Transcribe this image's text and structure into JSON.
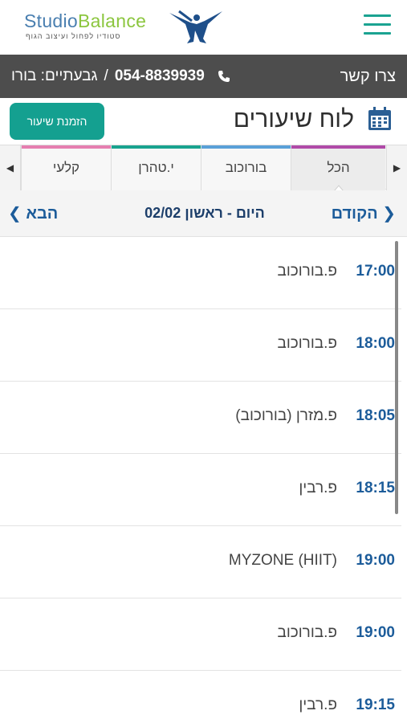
{
  "header": {
    "logo_studio": "Studio",
    "logo_balance": "Balance",
    "logo_tagline": "סטודיו לפחול ועיצוב הגוף"
  },
  "contact": {
    "label": "צרו קשר",
    "phone": "054-8839939",
    "branch": "גבעתיים: בורו",
    "separator": "/"
  },
  "title": {
    "text": "לוח שיעורים",
    "book_button": "הזמנת שיעור"
  },
  "tabs": [
    {
      "label": "הכל",
      "color": "#b04aa8"
    },
    {
      "label": "בורוכוב",
      "color": "#5aa0d8"
    },
    {
      "label": "י.טהרן",
      "color": "#19a38f"
    },
    {
      "label": "קלעי",
      "color": "#e67fb0"
    }
  ],
  "date_nav": {
    "prev": "הקודם",
    "next": "הבא",
    "date": "היום - ראשון 02/02"
  },
  "schedule": [
    {
      "time": "17:00",
      "class": "פ.בורוכוב"
    },
    {
      "time": "18:00",
      "class": "פ.בורוכוב"
    },
    {
      "time": "18:05",
      "class": "פ.מזרן (בורוכוב)"
    },
    {
      "time": "18:15",
      "class": "פ.רבין"
    },
    {
      "time": "19:00",
      "class": "MYZONE (HIIT)"
    },
    {
      "time": "19:00",
      "class": "פ.בורוכוב"
    },
    {
      "time": "19:15",
      "class": "פ.רבין"
    }
  ],
  "colors": {
    "accent": "#14a090",
    "link": "#1c5c9a",
    "contact_bar": "#4d4d4d"
  }
}
